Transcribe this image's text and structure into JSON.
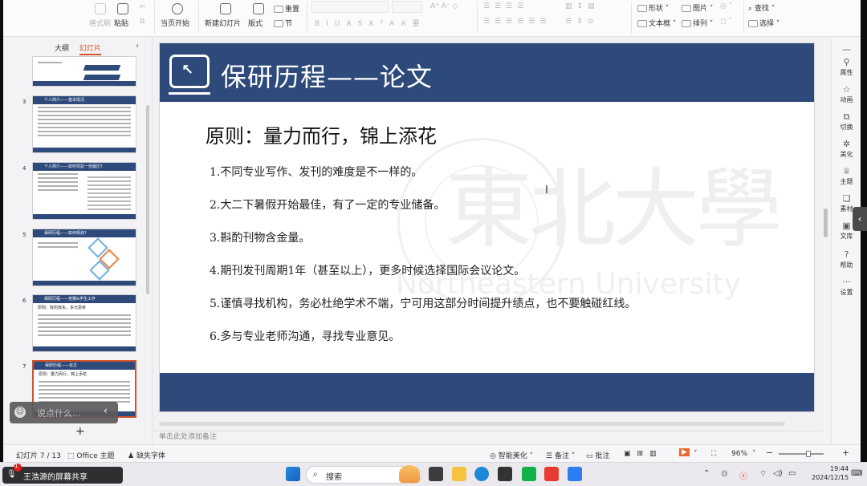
{
  "ribbon": {
    "format_painter": "格式刷",
    "paste": "粘贴",
    "start_from_current": "当页开始",
    "new_slide": "新建幻灯片",
    "layout": "版式",
    "reset": "重置",
    "section": "节",
    "shapes": "形状",
    "picture": "图片",
    "find": "查找",
    "textbox": "文本框",
    "arrange": "排列",
    "select": "选择",
    "font_buttons": [
      "B",
      "I",
      "U",
      "A",
      "S",
      "X²",
      "A",
      "A",
      "要"
    ]
  },
  "left_panel": {
    "tab_outline": "大纲",
    "tab_slides": "幻灯片",
    "thumbnails": [
      {
        "num": "",
        "title": ""
      },
      {
        "num": "3",
        "title": "个人简介——基本情况"
      },
      {
        "num": "4",
        "title": "个人简介——如何驾驭一份履历?"
      },
      {
        "num": "5",
        "title": "保研历程——如何规划?"
      },
      {
        "num": "6",
        "title": "保研历程——竞赛&学生工作"
      },
      {
        "num": "7",
        "title": "保研历程——论文"
      }
    ],
    "thumb6_sub": "原则：有的放矢，多元思考",
    "thumb7_sub": "原则：量力而行，锦上添花",
    "add_slide": "+"
  },
  "note_widget": {
    "placeholder": "说点什么..."
  },
  "slide": {
    "title": "保研历程——论文",
    "principle": "原则：量力而行，锦上添花",
    "items": [
      "1.不同专业写作、发刊的难度是不一样的。",
      "2.大二下暑假开始最佳，有了一定的专业储备。",
      "3.斟酌刊物含金量。",
      "4.期刊发刊周期1年（甚至以上），更多时候选择国际会议论文。",
      "5.谨慎寻找机构，务必杜绝学术不端，宁可用这部分时间提升绩点，也不要触碰红线。",
      "6.多与专业老师沟通，寻找专业意见。"
    ],
    "watermark_cn": "東北大學",
    "watermark_en": "Northeastern University"
  },
  "notes_placeholder": "单击此处添加备注",
  "right_rail": [
    "属性",
    "动画",
    "切换",
    "美化",
    "主题",
    "素材",
    "文库",
    "帮助",
    "设置"
  ],
  "status_bar": {
    "slide_count": "幻灯片 7 / 13",
    "theme": "Office 主题",
    "missing_font": "缺失字体",
    "smart_beautify": "智能美化",
    "notes": "备注",
    "comments": "批注",
    "zoom": "96%"
  },
  "taskbar": {
    "share_text": "王浩源的屏幕共享",
    "notification_count": "1",
    "search": "搜索",
    "time": "19:44",
    "date": "2024/12/15"
  },
  "colors": {
    "slide_blue": "#2d4a7a",
    "accent": "#d4532a"
  }
}
